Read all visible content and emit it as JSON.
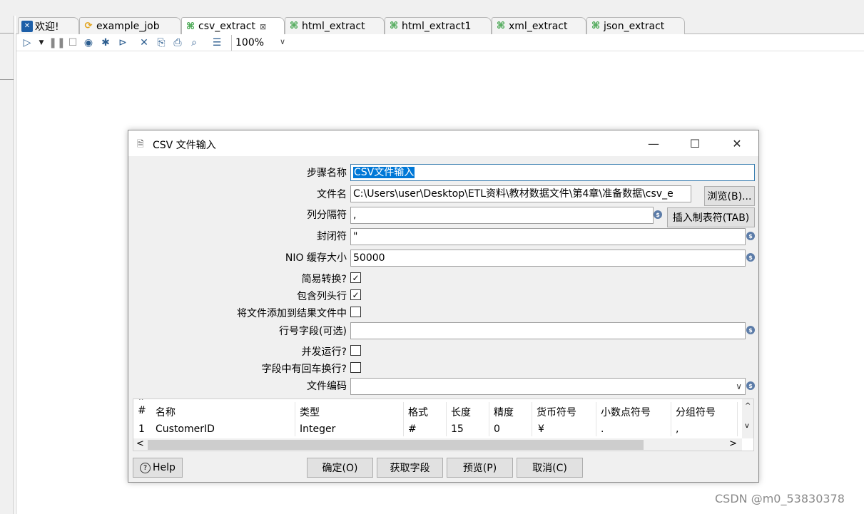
{
  "tabs": [
    {
      "label": "欢迎!",
      "icon": "welcome-icon",
      "color": "#1d5fa8"
    },
    {
      "label": "example_job",
      "icon": "job-icon",
      "color": "#e2a31c"
    },
    {
      "label": "csv_extract",
      "icon": "transformation-icon",
      "color": "#2e9b3a",
      "close": "⊠"
    },
    {
      "label": "html_extract",
      "icon": "transformation-icon",
      "color": "#2e9b3a"
    },
    {
      "label": "html_extract1",
      "icon": "transformation-icon",
      "color": "#2e9b3a"
    },
    {
      "label": "xml_extract",
      "icon": "transformation-icon",
      "color": "#2e9b3a"
    },
    {
      "label": "json_extract",
      "icon": "transformation-icon",
      "color": "#2e9b3a"
    }
  ],
  "toolbar": {
    "zoom": "100%"
  },
  "dialog": {
    "title": "CSV 文件输入",
    "fields": {
      "step_name_label": "步骤名称",
      "step_name_value": "CSV文件输入",
      "filename_label": "文件名",
      "filename_value": "C:\\Users\\user\\Desktop\\ETL资料\\教材数据文件\\第4章\\准备数据\\csv_e",
      "browse_button": "浏览(B)...",
      "delimiter_label": "列分隔符",
      "delimiter_value": ",",
      "insert_tab_button": "插入制表符(TAB)",
      "enclosure_label": "封闭符",
      "enclosure_value": "\"",
      "nio_label": "NIO 缓存大小",
      "nio_value": "50000",
      "lazy_label": "简易转换?",
      "header_label": "包含列头行",
      "add_result_label": "将文件添加到结果文件中",
      "rownum_label": "行号字段(可选)",
      "parallel_label": "并发运行?",
      "newline_label": "字段中有回车换行?",
      "encoding_label": "文件编码"
    },
    "checks": {
      "lazy": true,
      "header": true,
      "add_result": false,
      "parallel": false,
      "newline": false
    },
    "table": {
      "headers": [
        "#",
        "名称",
        "类型",
        "格式",
        "长度",
        "精度",
        "货币符号",
        "小数点符号",
        "分组符号"
      ],
      "rows": [
        [
          "1",
          "CustomerID",
          "Integer",
          "#",
          "15",
          "0",
          "¥",
          ".",
          ","
        ]
      ]
    },
    "buttons": {
      "help": "Help",
      "ok": "确定(O)",
      "get_fields": "获取字段",
      "preview": "预览(P)",
      "cancel": "取消(C)"
    }
  },
  "watermark": "CSDN @m0_53830378"
}
